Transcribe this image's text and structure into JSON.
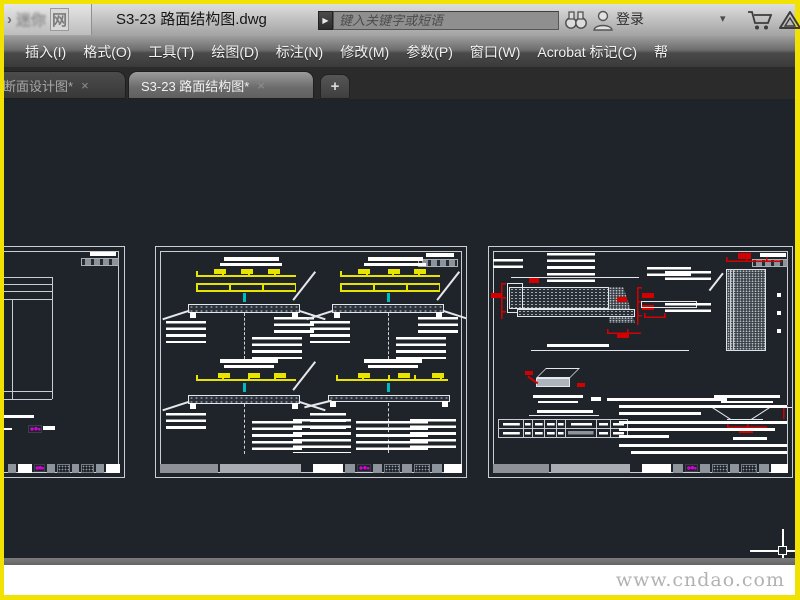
{
  "window": {
    "logo_chevron": "›",
    "logo_blur_text": "迷你",
    "logo_net": "网",
    "title_filename": "S3-23 路面结构图.dwg",
    "search_arrow_glyph": "▶",
    "search_placeholder": "键入关键字或短语",
    "login_label": "登录",
    "caret_glyph": "▾",
    "icons": [
      "binoculars-icon",
      "user-icon",
      "cart-icon",
      "exchange-triangle-icon"
    ]
  },
  "menubar": {
    "items": [
      "插入(I)",
      "格式(O)",
      "工具(T)",
      "绘图(D)",
      "标注(N)",
      "修改(M)",
      "参数(P)",
      "窗口(W)",
      "Acrobat 标记(C)",
      "帮"
    ]
  },
  "tabbar": {
    "tabs": [
      {
        "label": "断面设计图*",
        "active": false
      },
      {
        "label": "S3-23 路面结构图*",
        "active": true
      }
    ],
    "close_glyph": "×",
    "new_tab_glyph": "+"
  },
  "footer": {
    "watermark": "www.cndao.com"
  },
  "colors": {
    "frame_yellow": "#f2e203",
    "canvas_bg": "#1f242b",
    "cad_yellow": "#e8e400",
    "cad_red": "#d40000",
    "cad_magenta": "#d400d4",
    "cad_cyan": "#00bcbc",
    "sheet_border": "#c9ced4"
  }
}
